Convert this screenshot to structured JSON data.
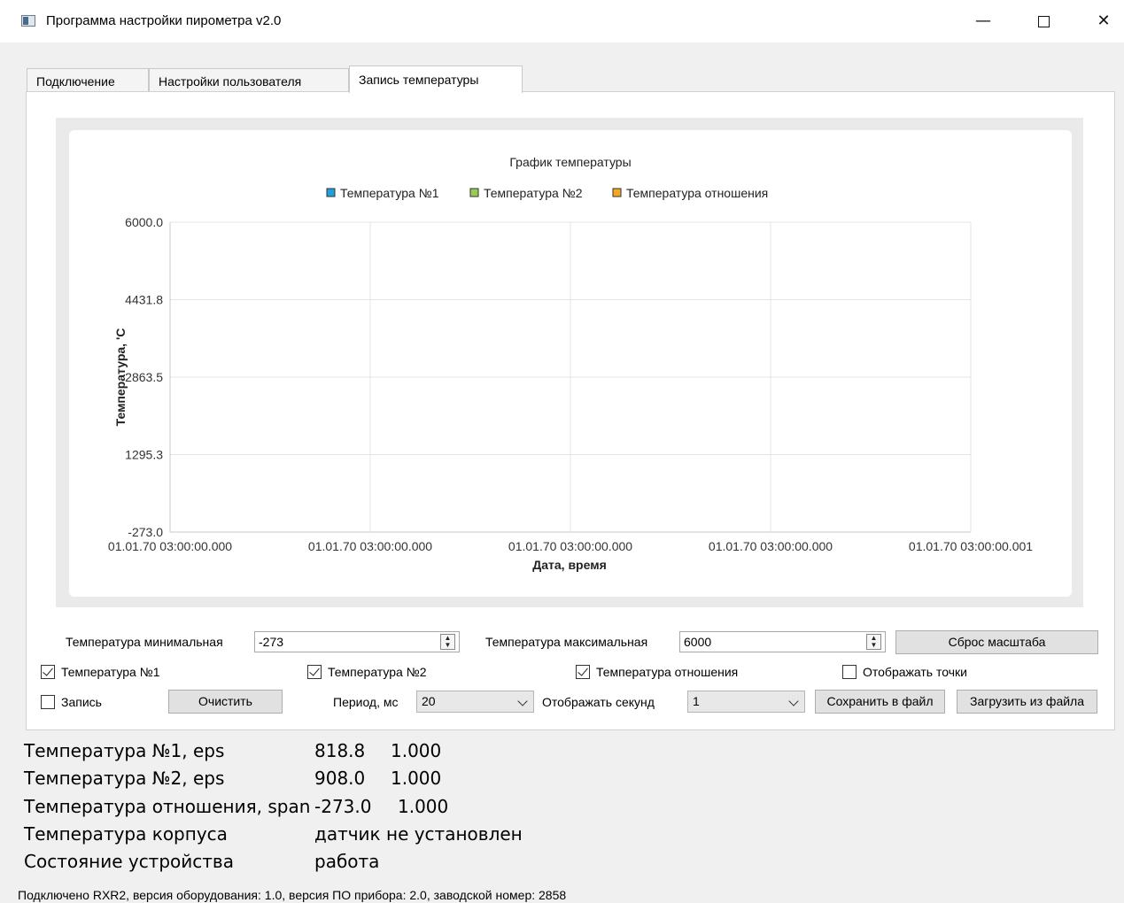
{
  "window": {
    "title": "Программа настройки пирометра v2.0",
    "minimize_glyph": "—",
    "close_glyph": "✕"
  },
  "tabs": [
    {
      "label": "Подключение",
      "active": false
    },
    {
      "label": "Настройки пользователя",
      "active": false
    },
    {
      "label": "Запись температуры",
      "active": true
    }
  ],
  "chart_data": {
    "type": "line",
    "title": "График температуры",
    "xlabel": "Дата, время",
    "ylabel": "Температура, 'С",
    "ylim": [
      -273.0,
      6000.0
    ],
    "y_ticks": [
      "6000.0",
      "4431.8",
      "2863.5",
      "1295.3",
      "-273.0"
    ],
    "x_ticks": [
      "01.01.70 03:00:00.000",
      "01.01.70 03:00:00.000",
      "01.01.70 03:00:00.000",
      "01.01.70 03:00:00.000",
      "01.01.70 03:00:00.001"
    ],
    "grid": true,
    "legend_position": "top-center",
    "series": [
      {
        "name": "Температура №1",
        "color": "#209fdf",
        "values": []
      },
      {
        "name": "Температура №2",
        "color": "#99ca53",
        "values": []
      },
      {
        "name": "Температура отношения",
        "color": "#f6a625",
        "values": []
      }
    ]
  },
  "controls": {
    "temp_min_label": "Температура минимальная",
    "temp_min_value": "-273",
    "temp_max_label": "Температура максимальная",
    "temp_max_value": "6000",
    "reset_scale_button": "Сброс масштаба",
    "checkboxes": [
      {
        "label": "Температура №1",
        "checked": true
      },
      {
        "label": "Температура №2",
        "checked": true
      },
      {
        "label": "Температура отношения",
        "checked": true
      },
      {
        "label": "Отображать точки",
        "checked": false
      }
    ],
    "record_checkbox": {
      "label": "Запись",
      "checked": false
    },
    "clear_button": "Очистить",
    "period_label": "Период, мс",
    "period_value": "20",
    "show_seconds_label": "Отображать секунд",
    "show_seconds_value": "1",
    "save_button": "Сохранить в файл",
    "load_button": "Загрузить из файла"
  },
  "readings": [
    {
      "label": "Температура №1, eps",
      "value": "818.8",
      "extra": "1.000"
    },
    {
      "label": "Температура №2, eps",
      "value": "908.0",
      "extra": "1.000"
    },
    {
      "label": "Температура отношения, span",
      "value": "-273.0",
      "extra": "1.000"
    },
    {
      "label": "Температура корпуса",
      "value": "датчик не установлен",
      "extra": ""
    },
    {
      "label": "Состояние устройства",
      "value": "работа",
      "extra": ""
    }
  ],
  "status_bar": "Подключено RXR2, версия оборудования: 1.0, версия ПО прибора: 2.0, заводской номер: 2858"
}
